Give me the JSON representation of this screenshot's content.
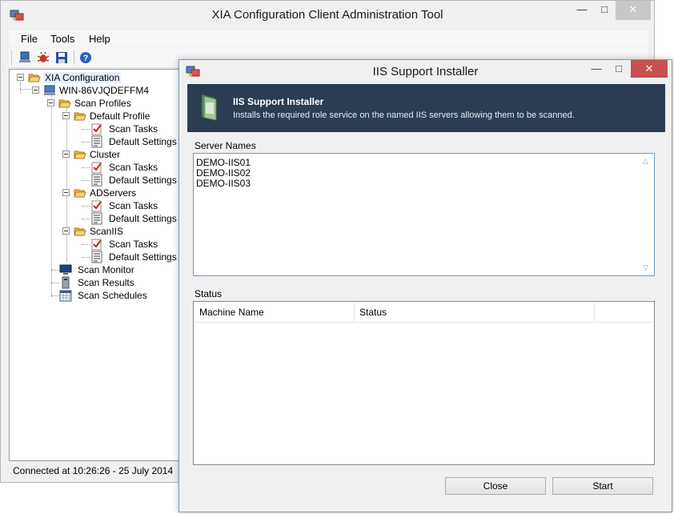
{
  "main_window": {
    "title": "XIA Configuration Client Administration Tool",
    "menu": [
      "File",
      "Tools",
      "Help"
    ],
    "toolbar_icons": [
      "computer-icon",
      "bug-icon",
      "save-icon",
      "help-icon"
    ],
    "tree": {
      "root": "XIA Configuration",
      "server": "WIN-86VJQDEFFM4",
      "scan_profiles": "Scan Profiles",
      "profiles": [
        {
          "name": "Default Profile",
          "children": [
            "Scan Tasks",
            "Default Settings"
          ]
        },
        {
          "name": "Cluster",
          "children": [
            "Scan Tasks",
            "Default Settings"
          ]
        },
        {
          "name": "ADServers",
          "children": [
            "Scan Tasks",
            "Default Settings"
          ]
        },
        {
          "name": "ScanIIS",
          "children": [
            "Scan Tasks",
            "Default Settings"
          ]
        }
      ],
      "scan_monitor": "Scan Monitor",
      "scan_results": "Scan Results",
      "scan_schedules": "Scan Schedules"
    },
    "status_text": "Connected at 10:26:26 - 25 July 2014"
  },
  "dialog": {
    "title": "IIS Support Installer",
    "banner_title": "IIS Support Installer",
    "banner_subtitle": "Installs the required role service on the named IIS servers allowing them to be scanned.",
    "server_names_label": "Server Names",
    "server_names": [
      "DEMO-IIS01",
      "DEMO-IIS02",
      "DEMO-IIS03"
    ],
    "status_label": "Status",
    "columns": [
      "Machine Name",
      "Status"
    ],
    "rows": [],
    "close_label": "Close",
    "start_label": "Start"
  },
  "colors": {
    "banner": "#2c3d52",
    "close_button_active": "#c75050",
    "selection": "#e5f0fb"
  }
}
